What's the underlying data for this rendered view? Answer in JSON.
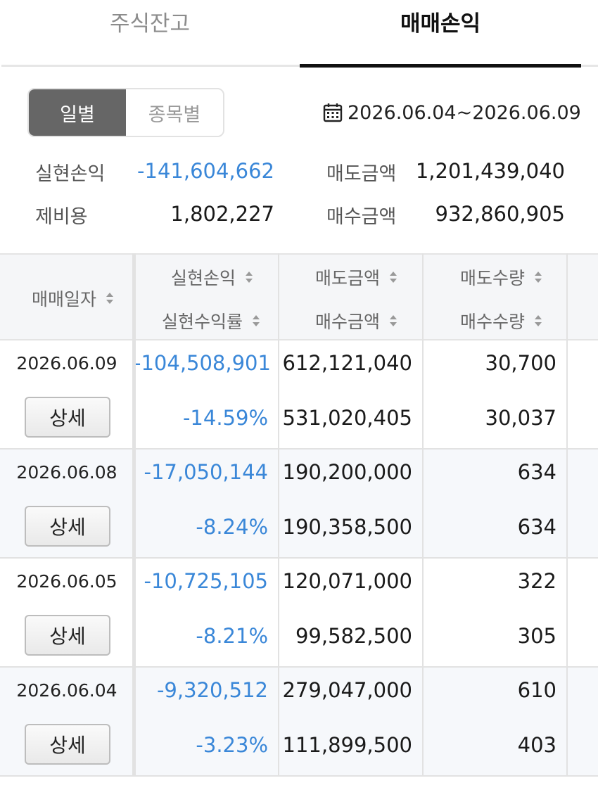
{
  "tabs": {
    "holdings": "주식잔고",
    "pnl": "매매손익"
  },
  "toggle": {
    "daily": "일별",
    "by_stock": "종목별"
  },
  "date_range": "2026.06.04~2026.06.09",
  "summary": {
    "realized_pnl_label": "실현손익",
    "realized_pnl": "-141,604,662",
    "sell_amount_label": "매도금액",
    "sell_amount": "1,201,439,040",
    "fees_label": "제비용",
    "fees": "1,802,227",
    "buy_amount_label": "매수금액",
    "buy_amount": "932,860,905"
  },
  "table": {
    "headers": {
      "trade_date": "매매일자",
      "realized_pnl": "실현손익",
      "realized_rate": "실현수익률",
      "sell_amount": "매도금액",
      "buy_amount": "매수금액",
      "sell_qty": "매도수량",
      "buy_qty": "매수수량"
    },
    "detail_label": "상세",
    "rows": [
      {
        "date": "2026.06.09",
        "pnl": "-104,508,901",
        "rate": "-14.59%",
        "sell_amt": "612,121,040",
        "buy_amt": "531,020,405",
        "sell_qty": "30,700",
        "buy_qty": "30,037"
      },
      {
        "date": "2026.06.08",
        "pnl": "-17,050,144",
        "rate": "-8.24%",
        "sell_amt": "190,200,000",
        "buy_amt": "190,358,500",
        "sell_qty": "634",
        "buy_qty": "634"
      },
      {
        "date": "2026.06.05",
        "pnl": "-10,725,105",
        "rate": "-8.21%",
        "sell_amt": "120,071,000",
        "buy_amt": "99,582,500",
        "sell_qty": "322",
        "buy_qty": "305"
      },
      {
        "date": "2026.06.04",
        "pnl": "-9,320,512",
        "rate": "-3.23%",
        "sell_amt": "279,047,000",
        "buy_amt": "111,899,500",
        "sell_qty": "610",
        "buy_qty": "403"
      }
    ]
  },
  "colors": {
    "negative": "#3a87d8",
    "active_tab": "#111111",
    "toggle_on": "#666666"
  }
}
